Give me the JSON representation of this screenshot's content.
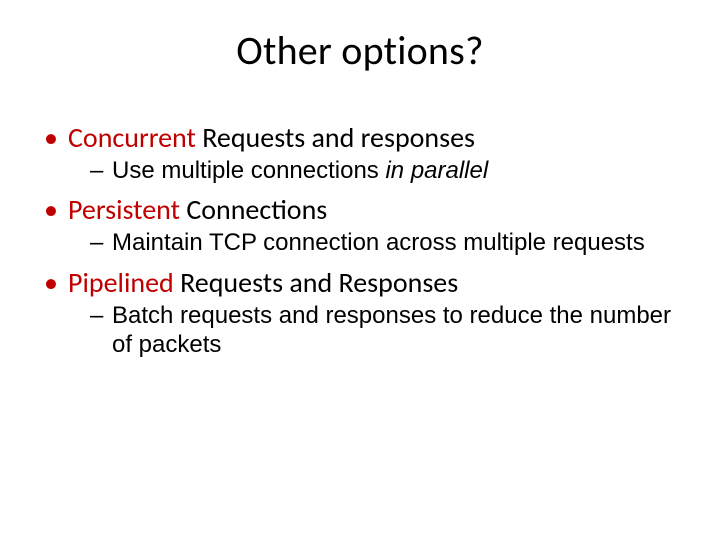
{
  "title": "Other options?",
  "bullets": [
    {
      "hl": "Concurrent",
      "rest": " Requests and responses",
      "subs": [
        {
          "pre": "Use multiple connections ",
          "ital": "in parallel",
          "post": ""
        }
      ]
    },
    {
      "hl": "Persistent",
      "rest": " Connections",
      "subs": [
        {
          "pre": "Maintain TCP connection across multiple requests",
          "ital": "",
          "post": ""
        }
      ]
    },
    {
      "hl": "Pipelined",
      "rest": " Requests and Responses",
      "subs": [
        {
          "pre": "Batch requests and responses to reduce the number of packets",
          "ital": "",
          "post": ""
        }
      ]
    }
  ]
}
